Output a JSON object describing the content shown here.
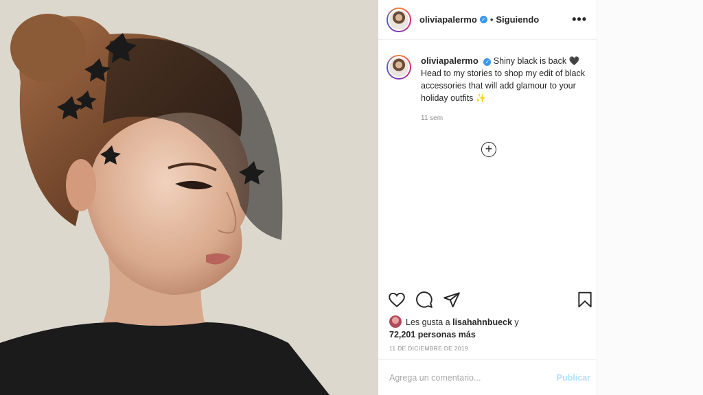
{
  "header": {
    "username": "oliviapalermo",
    "separator": "•",
    "following_label": "Siguiendo",
    "more_label": "•••"
  },
  "caption": {
    "username": "oliviapalermo",
    "text": "Shiny black is back 🖤 Head to my stories to shop my edit of black accessories that will add glamour to your holiday outfits ✨",
    "time": "11 sem"
  },
  "add_comment_icon": "+",
  "actions": {
    "like_icon": "heart-icon",
    "comment_icon": "comment-icon",
    "share_icon": "share-icon",
    "save_icon": "bookmark-icon"
  },
  "likes": {
    "prefix": "Les gusta a ",
    "user": "lisahahnbueck",
    "middle": " y ",
    "count": "72,201 personas más"
  },
  "date": "11 DE DICIEMBRE DE 2019",
  "comment": {
    "placeholder": "Agrega un comentario...",
    "publish_label": "Publicar"
  },
  "colors": {
    "verified": "#3897f0",
    "publish": "#b2dffc",
    "muted": "#8e8e8e"
  }
}
